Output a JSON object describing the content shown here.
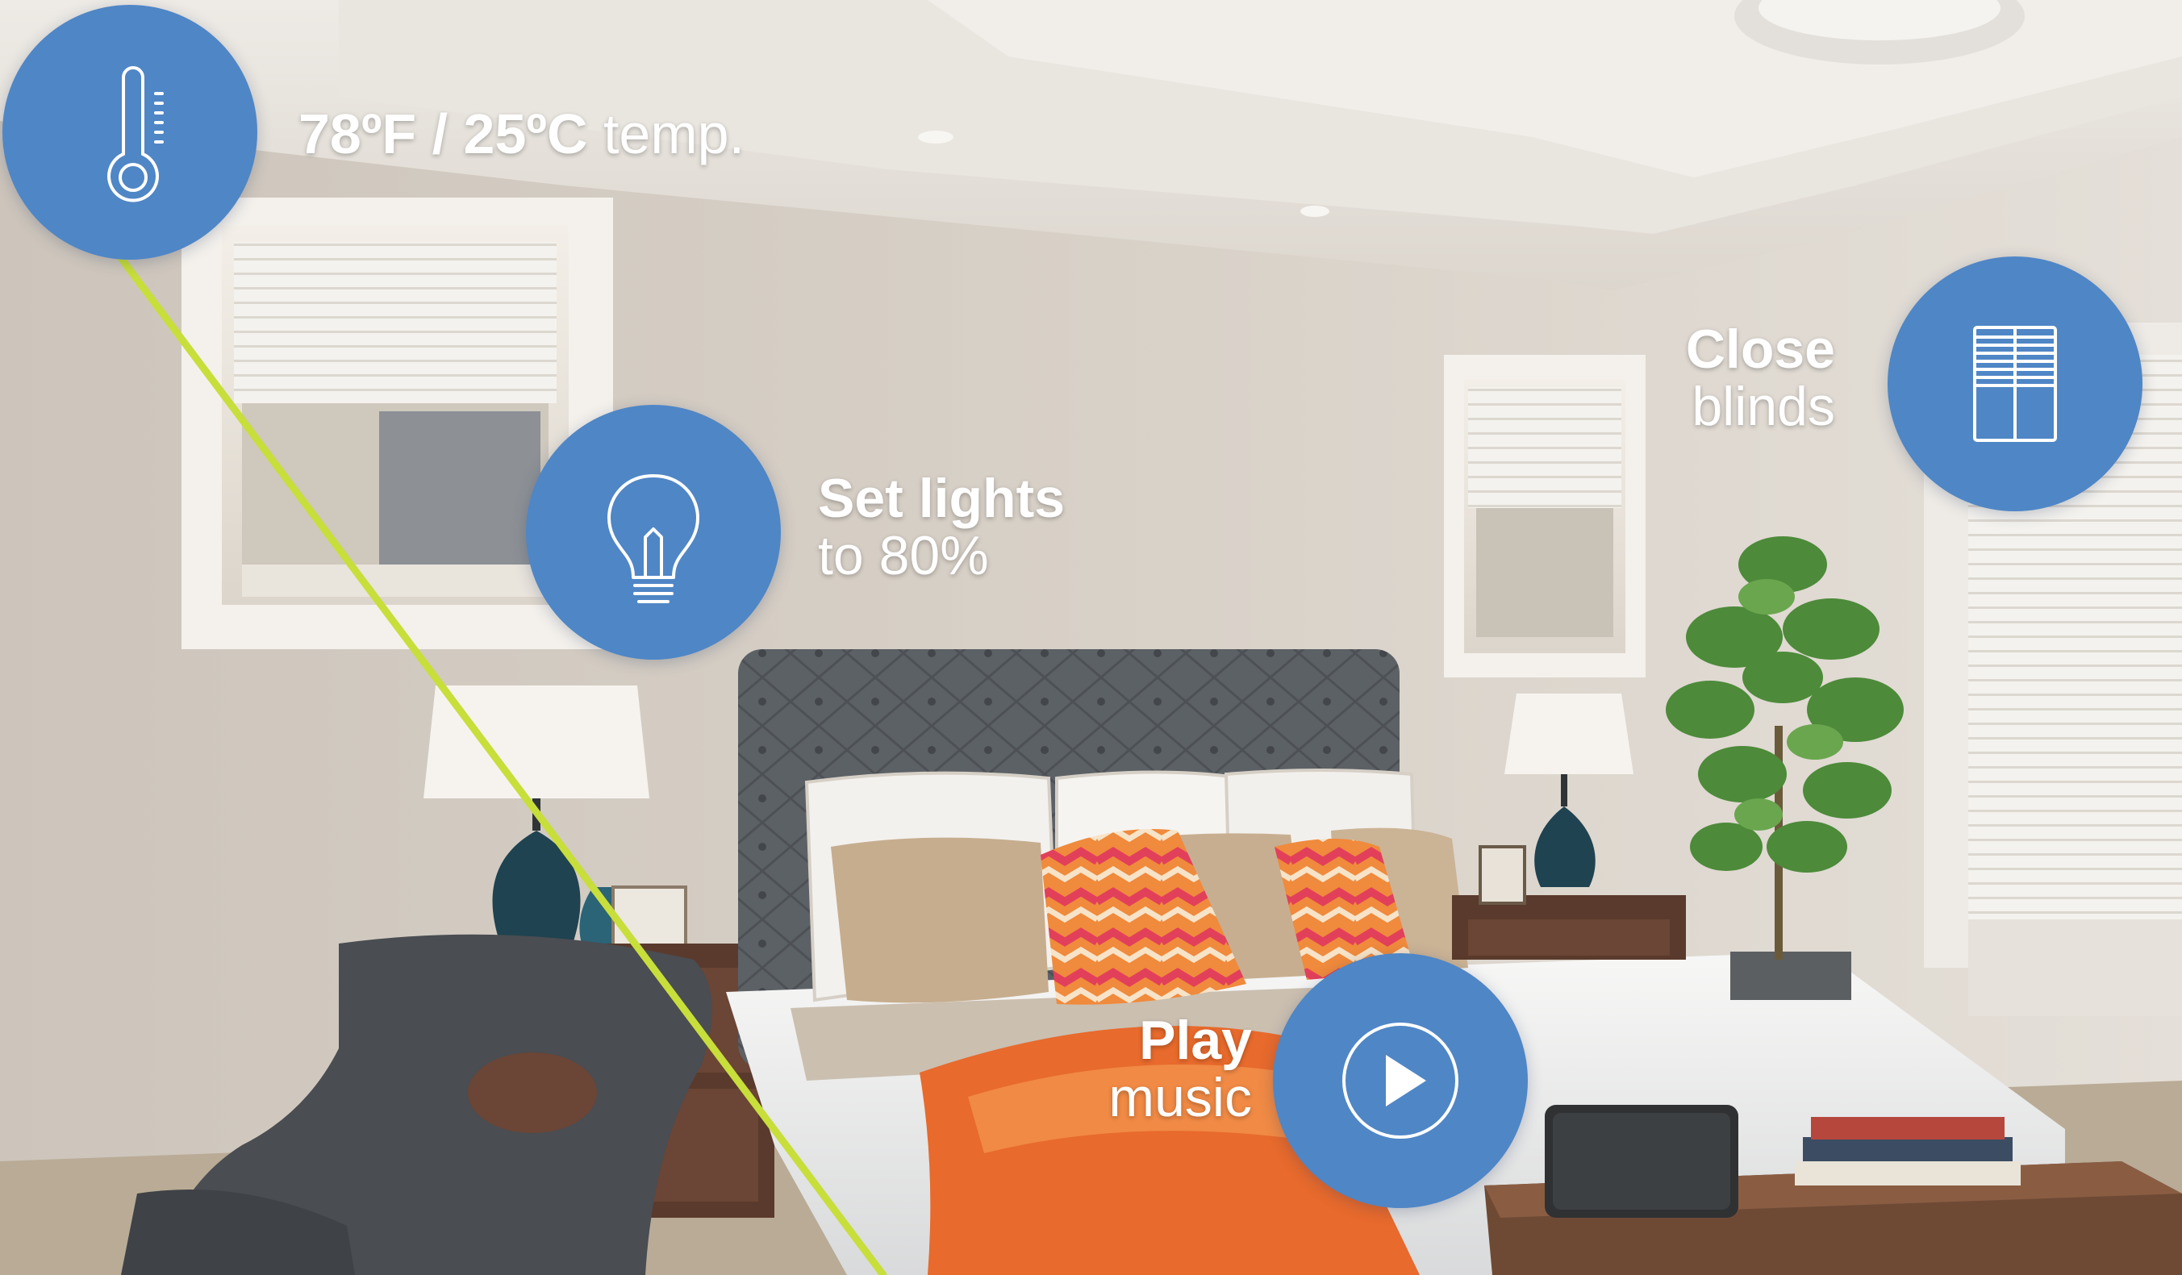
{
  "controls": {
    "temperature": {
      "value_text": "78ºF / 25ºC",
      "suffix": "temp.",
      "icon": "thermometer-icon"
    },
    "lights": {
      "line1": "Set lights",
      "line2": "to 80%",
      "level_percent": 80,
      "icon": "lightbulb-icon"
    },
    "blinds": {
      "line1": "Close",
      "line2": "blinds",
      "icon": "blinds-icon"
    },
    "music": {
      "line1": "Play",
      "line2": "music",
      "icon": "play-icon"
    }
  },
  "colors": {
    "accent_circle": "#4f86c6",
    "connector_line": "#c8de3a",
    "label_text": "#ffffff"
  }
}
